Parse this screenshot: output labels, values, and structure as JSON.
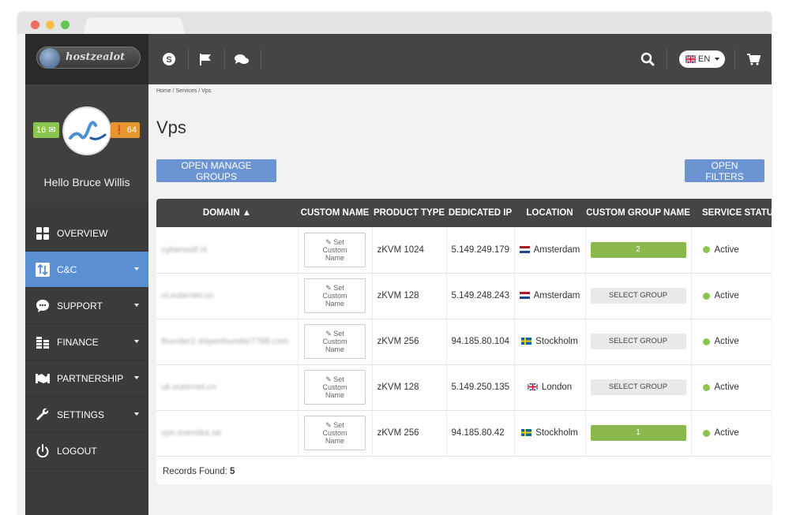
{
  "brand": {
    "logo_text": "hostzealot"
  },
  "profile": {
    "mail_count": "16",
    "alert_count": "64",
    "greeting": "Hello ",
    "user_name": "Bruce Willis"
  },
  "nav": [
    {
      "label": "OVERVIEW",
      "icon": "grid-icon",
      "active": false,
      "caret": false
    },
    {
      "label": "C&C",
      "icon": "sort-icon",
      "active": true,
      "caret": true
    },
    {
      "label": "SUPPORT",
      "icon": "chat-icon",
      "active": false,
      "caret": true
    },
    {
      "label": "FINANCE",
      "icon": "coins-icon",
      "active": false,
      "caret": true
    },
    {
      "label": "PARTNERSHIP",
      "icon": "handshake-icon",
      "active": false,
      "caret": true
    },
    {
      "label": "SETTINGS",
      "icon": "wrench-icon",
      "active": false,
      "caret": true
    },
    {
      "label": "LOGOUT",
      "icon": "power-icon",
      "active": false,
      "caret": false
    }
  ],
  "topbar": {
    "language": "EN"
  },
  "breadcrumb": "Home / Services / Vps",
  "page_title": "Vps",
  "buttons": {
    "manage_groups": "OPEN MANAGE GROUPS",
    "filters": "OPEN FILTERS"
  },
  "table": {
    "headers": [
      "DOMAIN ▲",
      "CUSTOM NAME",
      "PRODUCT TYPE",
      "DEDICATED IP",
      "LOCATION",
      "CUSTOM GROUP NAME",
      "SERVICE STATUS"
    ],
    "custom_name_label": [
      "Set",
      "Custom",
      "Name"
    ],
    "rows": [
      {
        "domain": "cyberwolf.nl",
        "product": "zKVM 1024",
        "ip": "5.149.249.179",
        "location": "Amsterdam",
        "flag": "nl",
        "group": "2",
        "group_set": true,
        "status": "Active"
      },
      {
        "domain": "nl.outernet.cn",
        "product": "zKVM 128",
        "ip": "5.149.248.243",
        "location": "Amsterdam",
        "flag": "nl",
        "group": "SELECT GROUP",
        "group_set": false,
        "status": "Active"
      },
      {
        "domain": "thunder2.slayerthunder7788.com",
        "product": "zKVM 256",
        "ip": "94.185.80.104",
        "location": "Stockholm",
        "flag": "se",
        "group": "SELECT GROUP",
        "group_set": false,
        "status": "Active"
      },
      {
        "domain": "uk.outernet.cn",
        "product": "zKVM 128",
        "ip": "5.149.250.135",
        "location": "London",
        "flag": "gb",
        "group": "SELECT GROUP",
        "group_set": false,
        "status": "Active"
      },
      {
        "domain": "vpn.svenska.se",
        "product": "zKVM 256",
        "ip": "94.185.80.42",
        "location": "Stockholm",
        "flag": "se",
        "group": "1",
        "group_set": true,
        "status": "Active"
      }
    ],
    "records_label": "Records Found: ",
    "records_count": "5"
  }
}
